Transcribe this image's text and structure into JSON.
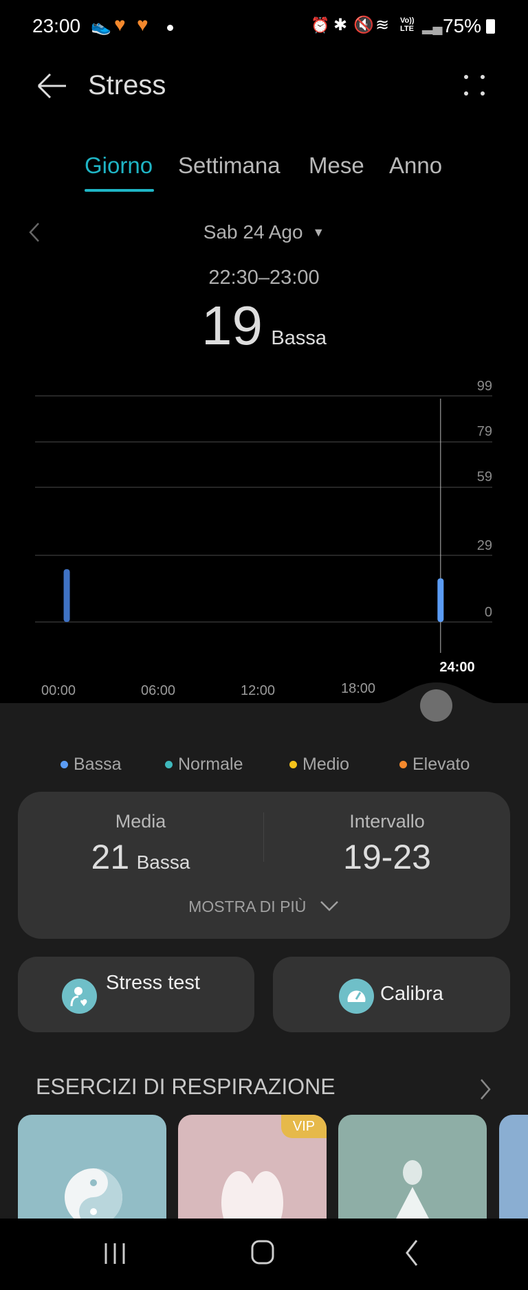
{
  "status_bar": {
    "time": "23:00",
    "battery": "75%",
    "icons": [
      "running-shoe-icon",
      "heart-icon",
      "heart-icon",
      "dot-icon",
      "alarm-icon",
      "bluetooth-icon",
      "mute-icon",
      "wifi-icon",
      "volte-icon",
      "signal-icon",
      "battery-icon"
    ],
    "volte_top": "Vo))",
    "volte_bottom": "LTE"
  },
  "header": {
    "title": "Stress"
  },
  "tabs": [
    {
      "label": "Giorno",
      "active": true
    },
    {
      "label": "Settimana"
    },
    {
      "label": "Mese"
    },
    {
      "label": "Anno"
    }
  ],
  "date": {
    "label": "Sab 24 Ago"
  },
  "reading": {
    "time_range": "22:30–23:00",
    "value": "19",
    "level": "Bassa"
  },
  "chart_data": {
    "type": "bar",
    "y_ticks": [
      99,
      79,
      59,
      29,
      0
    ],
    "ylim": [
      0,
      99
    ],
    "x_ticks": [
      "00:00",
      "06:00",
      "12:00",
      "18:00"
    ],
    "cursor_label": "24:00",
    "grid": true,
    "points": [
      {
        "hour": 0.5,
        "value": 23
      },
      {
        "hour": 23,
        "value": 19
      }
    ],
    "bar_colors": [
      "#3f72c4",
      "#5b9cf5"
    ]
  },
  "legend": [
    {
      "label": "Bassa",
      "color": "#5b9cf5"
    },
    {
      "label": "Normale",
      "color": "#3fb8bc"
    },
    {
      "label": "Medio",
      "color": "#f5c21b"
    },
    {
      "label": "Elevato",
      "color": "#f5892d"
    }
  ],
  "summary": {
    "media_label": "Media",
    "media_value": "21",
    "media_level": "Bassa",
    "range_label": "Intervallo",
    "range_value": "19-23",
    "more_label": "MOSTRA DI PIÙ"
  },
  "actions": {
    "stress_test": "Stress test",
    "calibrate": "Calibra"
  },
  "breathing": {
    "title": "ESERCIZI DI RESPIRAZIONE",
    "vip": "VIP",
    "cards": [
      {
        "color": "#92bdc6"
      },
      {
        "color": "#d8b9bc"
      },
      {
        "color": "#8eaea6"
      },
      {
        "color": "#8aaed2"
      }
    ]
  }
}
